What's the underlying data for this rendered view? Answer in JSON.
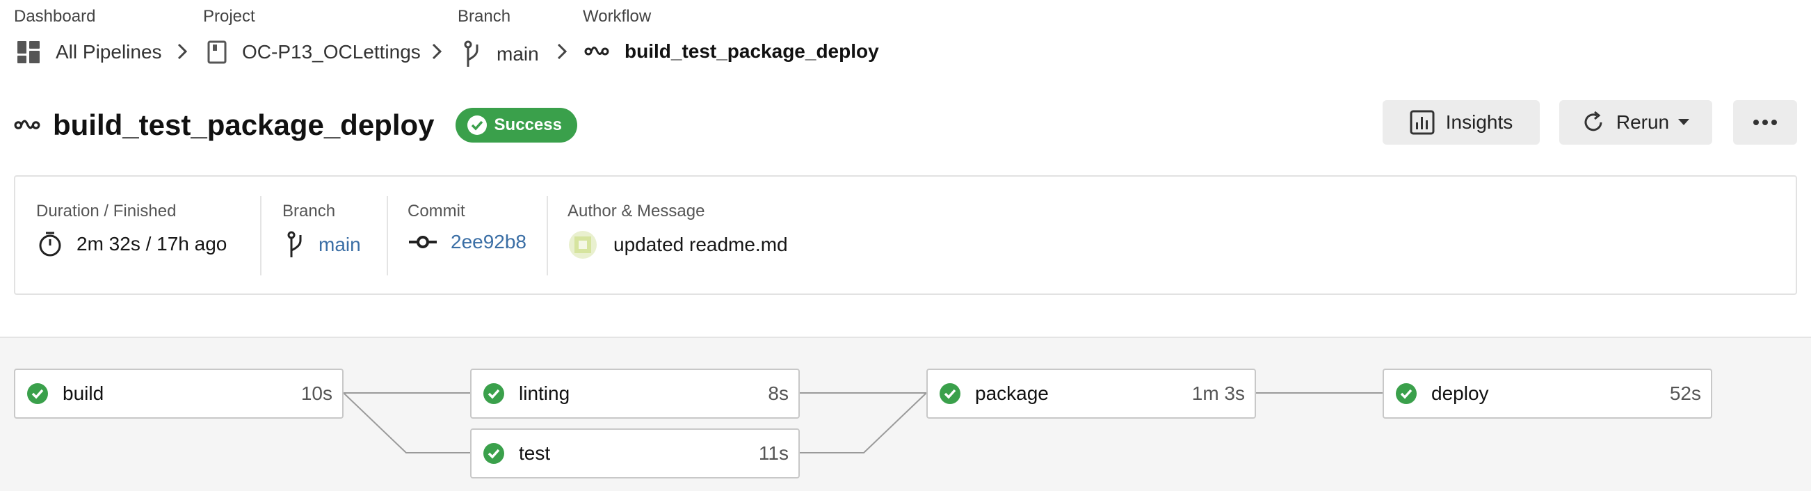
{
  "breadcrumb": {
    "dashboard": {
      "label": "Dashboard",
      "value": "All Pipelines"
    },
    "project": {
      "label": "Project",
      "value": "OC-P13_OCLettings"
    },
    "branch": {
      "label": "Branch",
      "value": "main"
    },
    "workflow": {
      "label": "Workflow",
      "value": "build_test_package_deploy"
    }
  },
  "header": {
    "title": "build_test_package_deploy",
    "status": "Success",
    "buttons": {
      "insights": "Insights",
      "rerun": "Rerun"
    }
  },
  "summary": {
    "duration_label": "Duration / Finished",
    "duration_value": "2m 32s / 17h ago",
    "branch_label": "Branch",
    "branch_value": "main",
    "commit_label": "Commit",
    "commit_value": "2ee92b8",
    "author_label": "Author & Message",
    "message": "updated readme.md"
  },
  "jobs": [
    {
      "name": "build",
      "duration": "10s",
      "status": "success"
    },
    {
      "name": "linting",
      "duration": "8s",
      "status": "success"
    },
    {
      "name": "test",
      "duration": "11s",
      "status": "success"
    },
    {
      "name": "package",
      "duration": "1m 3s",
      "status": "success"
    },
    {
      "name": "deploy",
      "duration": "52s",
      "status": "success"
    }
  ],
  "colors": {
    "success": "#3aa04b",
    "link": "#3a6ea5",
    "graph_bg": "#f5f5f5"
  }
}
